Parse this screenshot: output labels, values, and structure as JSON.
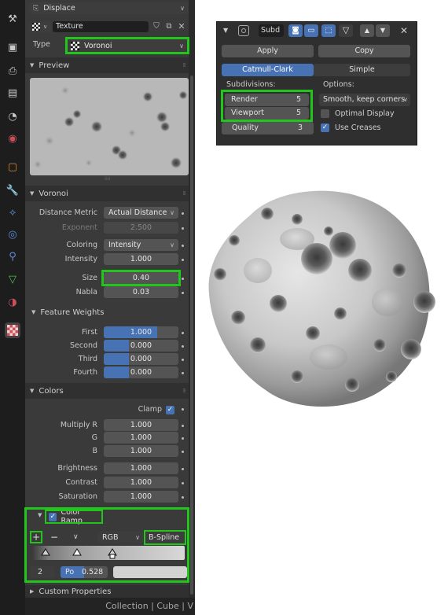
{
  "modifier_header": {
    "name": "Displace"
  },
  "texture": {
    "label": "Texture",
    "type_label": "Type",
    "type_value": "Voronoi"
  },
  "preview": {
    "header": "Preview"
  },
  "voronoi": {
    "header": "Voronoi",
    "distance_metric_label": "Distance Metric",
    "distance_metric_value": "Actual Distance",
    "exponent_label": "Exponent",
    "exponent_value": "2.500",
    "coloring_label": "Coloring",
    "coloring_value": "Intensity",
    "intensity_label": "Intensity",
    "intensity_value": "1.000",
    "size_label": "Size",
    "size_value": "0.40",
    "nabla_label": "Nabla",
    "nabla_value": "0.03"
  },
  "feature_weights": {
    "header": "Feature Weights",
    "rows": [
      {
        "label": "First",
        "value": "1.000",
        "fill": 0.72
      },
      {
        "label": "Second",
        "value": "0.000",
        "fill": 0.34
      },
      {
        "label": "Third",
        "value": "0.000",
        "fill": 0.34
      },
      {
        "label": "Fourth",
        "value": "0.000",
        "fill": 0.34
      }
    ]
  },
  "colors": {
    "header": "Colors",
    "clamp_label": "Clamp",
    "multiply_r_label": "Multiply R",
    "multiply_r_value": "1.000",
    "g_label": "G",
    "g_value": "1.000",
    "b_label": "B",
    "b_value": "1.000",
    "brightness_label": "Brightness",
    "brightness_value": "1.000",
    "contrast_label": "Contrast",
    "contrast_value": "1.000",
    "saturation_label": "Saturation",
    "saturation_value": "1.000"
  },
  "color_ramp": {
    "label": "Color Ramp",
    "add": "+",
    "remove": "−",
    "more": "∨",
    "mode": "RGB",
    "interpolation": "B-Spline",
    "index": "2",
    "pos_label": "Po",
    "pos_value": "0.528"
  },
  "custom_properties": {
    "header": "Custom Properties"
  },
  "status_bar": {
    "text": "Collection | Cube | V"
  },
  "subdivision": {
    "name": "Subd",
    "apply": "Apply",
    "copy": "Copy",
    "catmull_clark": "Catmull-Clark",
    "simple": "Simple",
    "subdivisions_label": "Subdivisions:",
    "render_label": "Render",
    "render_value": "5",
    "viewport_label": "Viewport",
    "viewport_value": "5",
    "quality_label": "Quality",
    "quality_value": "3",
    "options_label": "Options:",
    "uv_smooth": "Smooth, keep corners",
    "optimal_display": "Optimal Display",
    "use_creases": "Use Creases"
  },
  "colors_accent": {
    "blue": "#4772b3",
    "highlight": "#22c51c"
  }
}
